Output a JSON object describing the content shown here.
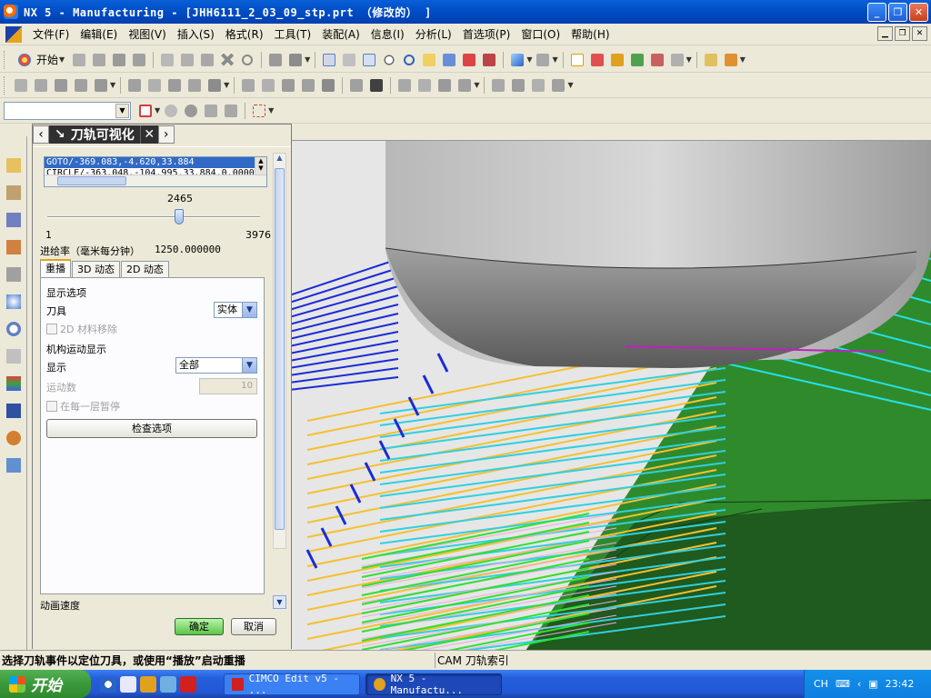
{
  "window": {
    "title": "NX 5 - Manufacturing - [JHH6111_2_03_09_stp.prt （修改的）  ]",
    "minimize": "_",
    "maximize": "❐",
    "close": "✕"
  },
  "menu": {
    "items": [
      "文件(F)",
      "编辑(E)",
      "视图(V)",
      "插入(S)",
      "格式(R)",
      "工具(T)",
      "装配(A)",
      "信息(I)",
      "分析(L)",
      "首选项(P)",
      "窗口(O)",
      "帮助(H)"
    ]
  },
  "toolbar": {
    "start_label": "开始"
  },
  "dialog": {
    "title": "刀轨可视化",
    "list_rows": [
      "GOTO/-369.083,-4.620,33.884",
      "CIRCLE/-363.048,-104.995,33.884,0.0000"
    ],
    "slider": {
      "value": "2465",
      "min": "1",
      "max": "3976",
      "fraction": 0.62
    },
    "feed_label": "进给率（毫米每分钟）",
    "feed_value": "1250.000000",
    "tabs": [
      "重播",
      "3D 动态",
      "2D 动态"
    ],
    "display_options": "显示选项",
    "tool_label": "刀具",
    "tool_value": "实体",
    "material_removal": "2D 材料移除",
    "motion_display": "机构运动显示",
    "display_label": "显示",
    "display_value": "全部",
    "motion_count_label": "运动数",
    "motion_count_value": "10",
    "pause_each_layer": "在每一层暂停",
    "check_options": "检查选项",
    "anim_speed": "动画速度",
    "ok": "确定",
    "cancel": "取消"
  },
  "status": {
    "left": "选择刀轨事件以定位刀具，或使用“播放”启动重播",
    "right": "CAM 刀轨索引"
  },
  "taskbar": {
    "start": "开始",
    "tasks": [
      "CIMCO Edit v5 - ...",
      "NX 5 - Manufactu..."
    ],
    "lang": "CH",
    "clock": "23:42"
  }
}
